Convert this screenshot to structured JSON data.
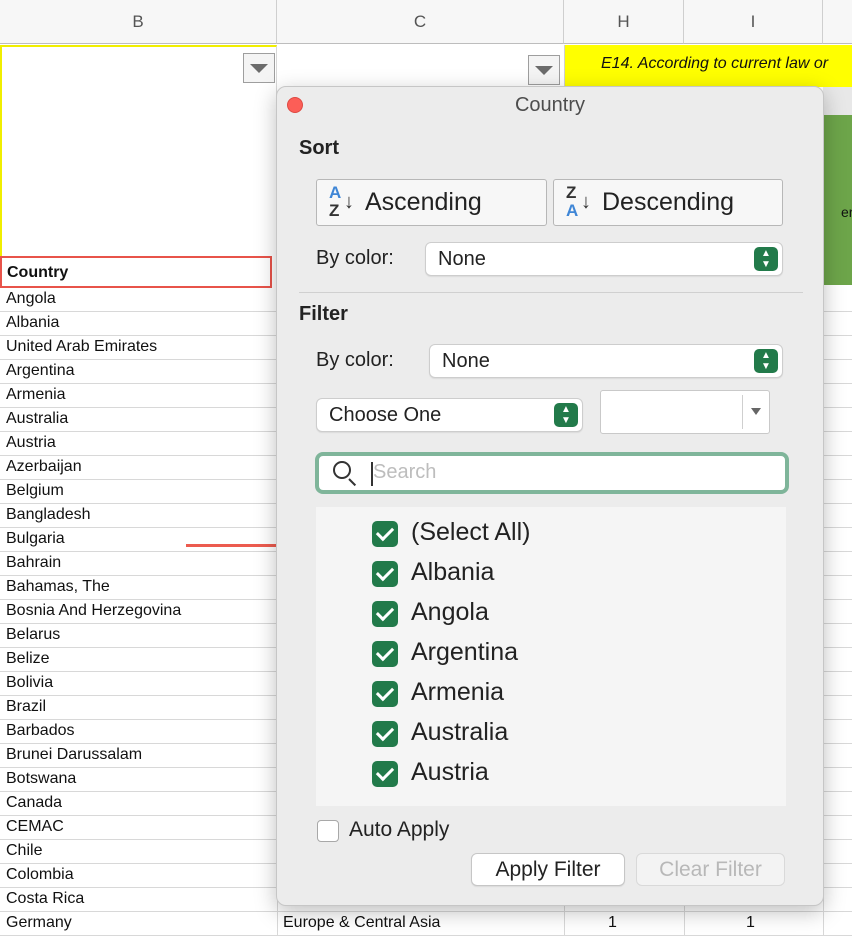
{
  "sheet": {
    "columns": [
      "B",
      "C",
      "H",
      "I"
    ],
    "header_h_text": "E14. According to current law or",
    "header_green_text": "er",
    "country_header": "Country",
    "rows": [
      "Angola",
      "Albania",
      "United Arab Emirates",
      "Argentina",
      "Armenia",
      "Australia",
      "Austria",
      "Azerbaijan",
      "Belgium",
      "Bangladesh",
      "Bulgaria",
      "Bahrain",
      "Bahamas, The",
      "Bosnia And Herzegovina",
      "Belarus",
      "Belize",
      "Bolivia",
      "Brazil",
      "Barbados",
      "Brunei Darussalam",
      "Botswana",
      "Canada",
      "CEMAC",
      "Chile",
      "Colombia",
      "Costa Rica"
    ],
    "last_row": {
      "b": "Germany",
      "c": "Europe & Central Asia",
      "h": "1",
      "i": "1"
    }
  },
  "popup": {
    "title": "Country",
    "sort": {
      "title": "Sort",
      "ascending_label": "Ascending",
      "descending_label": "Descending",
      "by_color_label": "By color:",
      "by_color_value": "None"
    },
    "filter": {
      "title": "Filter",
      "by_color_label": "By color:",
      "by_color_value": "None",
      "condition_value": "Choose One",
      "condition_text": "",
      "search_placeholder": "Search",
      "items": [
        {
          "label": "(Select All)",
          "checked": true
        },
        {
          "label": "Albania",
          "checked": true
        },
        {
          "label": "Angola",
          "checked": true
        },
        {
          "label": "Argentina",
          "checked": true
        },
        {
          "label": "Armenia",
          "checked": true
        },
        {
          "label": "Australia",
          "checked": true
        },
        {
          "label": "Austria",
          "checked": true
        }
      ]
    },
    "auto_apply_label": "Auto Apply",
    "auto_apply_checked": false,
    "apply_button": "Apply Filter",
    "clear_button": "Clear Filter"
  },
  "colors": {
    "accent_green": "#227a4a",
    "highlight_red": "#e8534a",
    "header_yellow": "#ffff00",
    "header_green": "#6da54a"
  }
}
